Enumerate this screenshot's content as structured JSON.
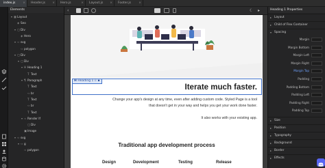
{
  "tabs": [
    {
      "label": "index.js",
      "active": true
    },
    {
      "label": "Header.js",
      "active": false
    },
    {
      "label": "Hero.js",
      "active": false
    },
    {
      "label": "Layout.js",
      "active": false
    },
    {
      "label": "Footer.js",
      "active": false
    }
  ],
  "tab_close_glyph": "×",
  "left_panel": {
    "title": "Elements",
    "tree": [
      {
        "label": "Layout",
        "depth": 0,
        "expanded": true,
        "icon": "layout-icon"
      },
      {
        "label": "Seo",
        "depth": 1,
        "expanded": false,
        "icon": "component-icon"
      },
      {
        "label": "Div",
        "depth": 1,
        "expanded": true,
        "icon": "div-icon"
      },
      {
        "label": "Hero",
        "depth": 2,
        "expanded": false,
        "icon": "component-icon"
      },
      {
        "label": "svg",
        "depth": 1,
        "expanded": true,
        "icon": "code-icon"
      },
      {
        "label": "polygon",
        "depth": 2,
        "expanded": false,
        "icon": "code-icon"
      },
      {
        "label": "Div",
        "depth": 1,
        "expanded": true,
        "icon": "div-icon"
      },
      {
        "label": "Div",
        "depth": 2,
        "expanded": true,
        "icon": "div-icon"
      },
      {
        "label": "Heading 1",
        "depth": 3,
        "expanded": true,
        "icon": "heading-icon"
      },
      {
        "label": "Text",
        "depth": 4,
        "expanded": false,
        "icon": "text-icon"
      },
      {
        "label": "Paragraph",
        "depth": 3,
        "expanded": true,
        "icon": "paragraph-icon"
      },
      {
        "label": "Text",
        "depth": 4,
        "expanded": false,
        "icon": "text-icon"
      },
      {
        "label": "br",
        "depth": 4,
        "expanded": false,
        "icon": "code-icon"
      },
      {
        "label": "Text",
        "depth": 4,
        "expanded": false,
        "icon": "text-icon"
      },
      {
        "label": "br",
        "depth": 4,
        "expanded": false,
        "icon": "code-icon"
      },
      {
        "label": "Text",
        "depth": 4,
        "expanded": false,
        "icon": "text-icon"
      },
      {
        "label": "Render If",
        "depth": 3,
        "expanded": true,
        "icon": "code-icon"
      },
      {
        "label": "Div",
        "depth": 4,
        "expanded": false,
        "icon": "div-icon"
      },
      {
        "label": "Image",
        "depth": 3,
        "expanded": false,
        "icon": "image-icon"
      },
      {
        "label": "svg",
        "depth": 1,
        "expanded": true,
        "icon": "code-icon"
      },
      {
        "label": "g",
        "depth": 2,
        "expanded": true,
        "icon": "code-icon"
      },
      {
        "label": "polygon",
        "depth": 3,
        "expanded": false,
        "icon": "code-icon"
      }
    ]
  },
  "canvas": {
    "selected_tag": "Heading 1",
    "heading": "Iterate much faster.",
    "paragraph_line1": "Change your app's design at any time, even after adding custom code. Styled Page is a tool",
    "paragraph_line2": "that doesn't get in your way and helps you get your work done faster.",
    "paragraph_line3": "It also works with your existing app.",
    "section_title": "Traditional app development process",
    "columns": [
      "Design",
      "Development",
      "Testing",
      "Release"
    ]
  },
  "right_panel": {
    "title": "Heading 1 Properties",
    "top_sections": [
      "Layout",
      "Child of Flex Container",
      "Spacing"
    ],
    "spacing_rows": [
      {
        "label": "Margin",
        "active": false
      },
      {
        "label": "Margin Bottom",
        "active": false
      },
      {
        "label": "Margin Left",
        "active": false
      },
      {
        "label": "Margin Right",
        "active": false
      },
      {
        "label": "Margin Top",
        "active": true
      },
      {
        "label": "Padding",
        "active": false
      },
      {
        "label": "Padding Bottom",
        "active": false
      },
      {
        "label": "Padding Left",
        "active": false
      },
      {
        "label": "Padding Right",
        "active": false
      },
      {
        "label": "Padding Top",
        "active": false
      }
    ],
    "bottom_sections": [
      "Size",
      "Position",
      "Typography",
      "Background",
      "Border",
      "Effects"
    ]
  },
  "colors": {
    "selection_blue": "#3d6fc8",
    "active_property": "#6fa3ff",
    "discord_brand": "#5865f2"
  }
}
